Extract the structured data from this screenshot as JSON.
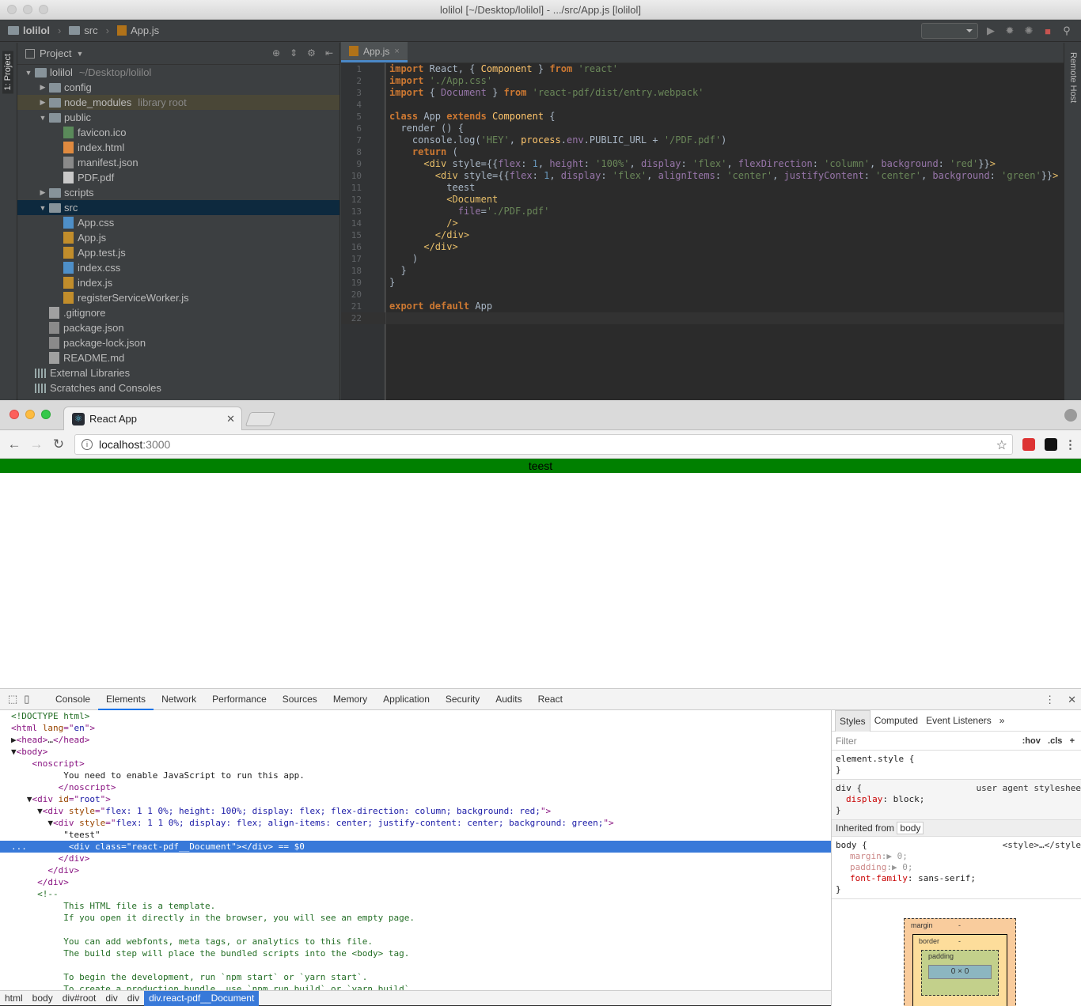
{
  "ide": {
    "window_title": "lolilol [~/Desktop/lolilol] - .../src/App.js [lolilol]",
    "breadcrumb": [
      "lolilol",
      "src",
      "App.js"
    ],
    "left_stripe_label": "1: Project",
    "right_stripe_label": "Remote Host",
    "project_panel": {
      "header": "Project",
      "tree": [
        {
          "label": "lolilol",
          "hint": "~/Desktop/lolilol",
          "type": "folder",
          "depth": 0,
          "expanded": true
        },
        {
          "label": "config",
          "type": "folder",
          "depth": 1,
          "expanded": false
        },
        {
          "label": "node_modules",
          "hint": "library root",
          "type": "folder",
          "depth": 1,
          "expanded": false
        },
        {
          "label": "public",
          "type": "folder",
          "depth": 1,
          "expanded": true
        },
        {
          "label": "favicon.ico",
          "type": "ico",
          "depth": 2
        },
        {
          "label": "index.html",
          "type": "html",
          "depth": 2
        },
        {
          "label": "manifest.json",
          "type": "json",
          "depth": 2
        },
        {
          "label": "PDF.pdf",
          "type": "pdf",
          "depth": 2
        },
        {
          "label": "scripts",
          "type": "folder",
          "depth": 1,
          "expanded": false
        },
        {
          "label": "src",
          "type": "folder",
          "depth": 1,
          "expanded": true
        },
        {
          "label": "App.css",
          "type": "css",
          "depth": 2
        },
        {
          "label": "App.js",
          "type": "js",
          "depth": 2
        },
        {
          "label": "App.test.js",
          "type": "js",
          "depth": 2
        },
        {
          "label": "index.css",
          "type": "css",
          "depth": 2
        },
        {
          "label": "index.js",
          "type": "js",
          "depth": 2
        },
        {
          "label": "registerServiceWorker.js",
          "type": "js",
          "depth": 2
        },
        {
          "label": ".gitignore",
          "type": "txt",
          "depth": 1
        },
        {
          "label": "package.json",
          "type": "json",
          "depth": 1
        },
        {
          "label": "package-lock.json",
          "type": "json",
          "depth": 1
        },
        {
          "label": "README.md",
          "type": "txt",
          "depth": 1
        },
        {
          "label": "External Libraries",
          "type": "lib",
          "depth": 0
        },
        {
          "label": "Scratches and Consoles",
          "type": "scratch",
          "depth": 0
        }
      ]
    },
    "editor": {
      "tab": "App.js",
      "lines": [
        [
          [
            "kw",
            "import"
          ],
          [
            "ct",
            " React, { "
          ],
          [
            "cls",
            "Component"
          ],
          [
            "ct",
            " } "
          ],
          [
            "kw",
            "from"
          ],
          [
            "st",
            " 'react'"
          ]
        ],
        [
          [
            "kw",
            "import"
          ],
          [
            "st",
            " './App.css'"
          ]
        ],
        [
          [
            "kw",
            "import"
          ],
          [
            "ct",
            " { "
          ],
          [
            "prop",
            "Document"
          ],
          [
            "ct",
            " } "
          ],
          [
            "kw",
            "from"
          ],
          [
            "st",
            " 'react-pdf/dist/entry.webpack'"
          ]
        ],
        [],
        [
          [
            "kw",
            "class"
          ],
          [
            "ct",
            " App "
          ],
          [
            "kw",
            "extends"
          ],
          [
            "cls",
            " Component"
          ],
          [
            "ct",
            " {"
          ]
        ],
        [
          [
            "ct",
            "  render () {"
          ]
        ],
        [
          [
            "ct",
            "    console.log("
          ],
          [
            "st",
            "'HEY'"
          ],
          [
            "ct",
            ", "
          ],
          [
            "cls",
            "process"
          ],
          [
            "ct",
            "."
          ],
          [
            "prop",
            "env"
          ],
          [
            "ct",
            ".PUBLIC_URL + "
          ],
          [
            "st",
            "'/PDF.pdf'"
          ],
          [
            "ct",
            ")"
          ]
        ],
        [
          [
            "kw",
            "    return"
          ],
          [
            "ct",
            " ("
          ]
        ],
        [
          [
            "tag",
            "      <div "
          ],
          [
            "ct",
            "style={{"
          ],
          [
            "prop",
            "flex"
          ],
          [
            "ct",
            ": "
          ],
          [
            "num",
            "1"
          ],
          [
            "ct",
            ", "
          ],
          [
            "prop",
            "height"
          ],
          [
            "ct",
            ": "
          ],
          [
            "st",
            "'100%'"
          ],
          [
            "ct",
            ", "
          ],
          [
            "prop",
            "display"
          ],
          [
            "ct",
            ": "
          ],
          [
            "st",
            "'flex'"
          ],
          [
            "ct",
            ", "
          ],
          [
            "prop",
            "flexDirection"
          ],
          [
            "ct",
            ": "
          ],
          [
            "st",
            "'column'"
          ],
          [
            "ct",
            ", "
          ],
          [
            "prop",
            "background"
          ],
          [
            "ct",
            ": "
          ],
          [
            "st",
            "'red'"
          ],
          [
            "ct",
            "}}"
          ],
          [
            "tag",
            ">"
          ]
        ],
        [
          [
            "tag",
            "        <div "
          ],
          [
            "ct",
            "style={{"
          ],
          [
            "prop",
            "flex"
          ],
          [
            "ct",
            ": "
          ],
          [
            "num",
            "1"
          ],
          [
            "ct",
            ", "
          ],
          [
            "prop",
            "display"
          ],
          [
            "ct",
            ": "
          ],
          [
            "st",
            "'flex'"
          ],
          [
            "ct",
            ", "
          ],
          [
            "prop",
            "alignItems"
          ],
          [
            "ct",
            ": "
          ],
          [
            "st",
            "'center'"
          ],
          [
            "ct",
            ", "
          ],
          [
            "prop",
            "justifyContent"
          ],
          [
            "ct",
            ": "
          ],
          [
            "st",
            "'center'"
          ],
          [
            "ct",
            ", "
          ],
          [
            "prop",
            "background"
          ],
          [
            "ct",
            ": "
          ],
          [
            "st",
            "'green'"
          ],
          [
            "ct",
            "}}"
          ],
          [
            "tag",
            ">"
          ]
        ],
        [
          [
            "ct",
            "          teest"
          ]
        ],
        [
          [
            "tag",
            "          <Document"
          ]
        ],
        [
          [
            "ct",
            "            "
          ],
          [
            "prop",
            "file"
          ],
          [
            "ct",
            "="
          ],
          [
            "st",
            "'./PDF.pdf'"
          ]
        ],
        [
          [
            "tag",
            "          />"
          ]
        ],
        [
          [
            "tag",
            "        </div>"
          ]
        ],
        [
          [
            "tag",
            "      </div>"
          ]
        ],
        [
          [
            "ct",
            "    )"
          ]
        ],
        [
          [
            "ct",
            "  }"
          ]
        ],
        [
          [
            "ct",
            "}"
          ]
        ],
        [],
        [
          [
            "kw",
            "export default"
          ],
          [
            "ct",
            " App"
          ]
        ],
        []
      ]
    }
  },
  "browser": {
    "tab_title": "React App",
    "url_host": "localhost",
    "url_port": ":3000",
    "page_text": "teest",
    "page_bg": "#008000",
    "devtools": {
      "tabs": [
        "Console",
        "Elements",
        "Network",
        "Performance",
        "Sources",
        "Memory",
        "Application",
        "Security",
        "Audits",
        "React"
      ],
      "active_tab": "Elements",
      "dom": [
        [
          [
            "cm",
            "<!DOCTYPE html>"
          ]
        ],
        [
          [
            "tg",
            "<html "
          ],
          [
            "an",
            "lang"
          ],
          [
            "tg",
            "=\""
          ],
          [
            "av",
            "en"
          ],
          [
            "tg",
            "\">"
          ]
        ],
        [
          [
            "tx",
            "▶"
          ],
          [
            "tg",
            "<head>"
          ],
          [
            "tx",
            "…"
          ],
          [
            "tg",
            "</head>"
          ]
        ],
        [
          [
            "tx",
            "▼"
          ],
          [
            "tg",
            "<body>"
          ]
        ],
        [
          [
            "tx",
            "    "
          ],
          [
            "tg",
            "<noscript>"
          ]
        ],
        [
          [
            "tx",
            "          You need to enable JavaScript to run this app."
          ]
        ],
        [
          [
            "tx",
            "         "
          ],
          [
            "tg",
            "</noscript>"
          ]
        ],
        [
          [
            "tx",
            "   ▼"
          ],
          [
            "tg",
            "<div "
          ],
          [
            "an",
            "id"
          ],
          [
            "tg",
            "=\""
          ],
          [
            "av",
            "root"
          ],
          [
            "tg",
            "\">"
          ]
        ],
        [
          [
            "tx",
            "     ▼"
          ],
          [
            "tg",
            "<div "
          ],
          [
            "an",
            "style"
          ],
          [
            "tg",
            "=\""
          ],
          [
            "av",
            "flex: 1 1 0%; height: 100%; display: flex; flex-direction: column; background: red;"
          ],
          [
            "tg",
            "\">"
          ]
        ],
        [
          [
            "tx",
            "       ▼"
          ],
          [
            "tg",
            "<div "
          ],
          [
            "an",
            "style"
          ],
          [
            "tg",
            "=\""
          ],
          [
            "av",
            "flex: 1 1 0%; display: flex; align-items: center; justify-content: center; background: green;"
          ],
          [
            "tg",
            "\">"
          ]
        ],
        [
          [
            "tx",
            "          \"teest\""
          ]
        ],
        [
          [
            "tx",
            "...        "
          ],
          [
            "tg",
            "<div "
          ],
          [
            "an",
            "class"
          ],
          [
            "tg",
            "=\""
          ],
          [
            "av",
            "react-pdf__Document"
          ],
          [
            "tg",
            "\"></div>"
          ],
          [
            "tx",
            " == $0"
          ]
        ],
        [
          [
            "tx",
            "         "
          ],
          [
            "tg",
            "</div>"
          ]
        ],
        [
          [
            "tx",
            "       "
          ],
          [
            "tg",
            "</div>"
          ]
        ],
        [
          [
            "tx",
            "     "
          ],
          [
            "tg",
            "</div>"
          ]
        ],
        [
          [
            "tx",
            "     "
          ],
          [
            "cm",
            "<!--"
          ]
        ],
        [
          [
            "cm",
            "          This HTML file is a template."
          ]
        ],
        [
          [
            "cm",
            "          If you open it directly in the browser, you will see an empty page."
          ]
        ],
        [
          [
            "cm",
            " "
          ]
        ],
        [
          [
            "cm",
            "          You can add webfonts, meta tags, or analytics to this file."
          ]
        ],
        [
          [
            "cm",
            "          The build step will place the bundled scripts into the <body> tag."
          ]
        ],
        [
          [
            "cm",
            " "
          ]
        ],
        [
          [
            "cm",
            "          To begin the development, run `npm start` or `yarn start`."
          ]
        ],
        [
          [
            "cm",
            "          To create a production bundle, use `npm run build` or `yarn build`."
          ]
        ],
        [
          [
            "cm",
            "        -->"
          ]
        ]
      ],
      "selected_dom_row": 11,
      "breadcrumbs": [
        "html",
        "body",
        "div#root",
        "div",
        "div",
        "div.react-pdf__Document"
      ],
      "styles": {
        "tabs": [
          "Styles",
          "Computed",
          "Event Listeners",
          "»"
        ],
        "filter_placeholder": "Filter",
        "hov": ":hov",
        "cls": ".cls",
        "element_style": "element.style {",
        "div_rule_selector": "div {",
        "div_rule_source": "user agent styleshee",
        "div_rule_prop": "display",
        "div_rule_val": ": block;",
        "inherited_label": "Inherited from",
        "inherited_el": "body",
        "body_selector": "body {",
        "body_source": "<style>…</style",
        "body_margin": "margin",
        "body_margin_val": ":▶ 0;",
        "body_padding": "padding",
        "body_padding_val": ":▶ 0;",
        "body_font": "font-family",
        "body_font_val": ": sans-serif;",
        "close_brace": "}",
        "box_margin": "margin",
        "box_border": "border",
        "box_padding": "padding",
        "box_dash": "-",
        "box_content": "0 × 0"
      }
    }
  }
}
